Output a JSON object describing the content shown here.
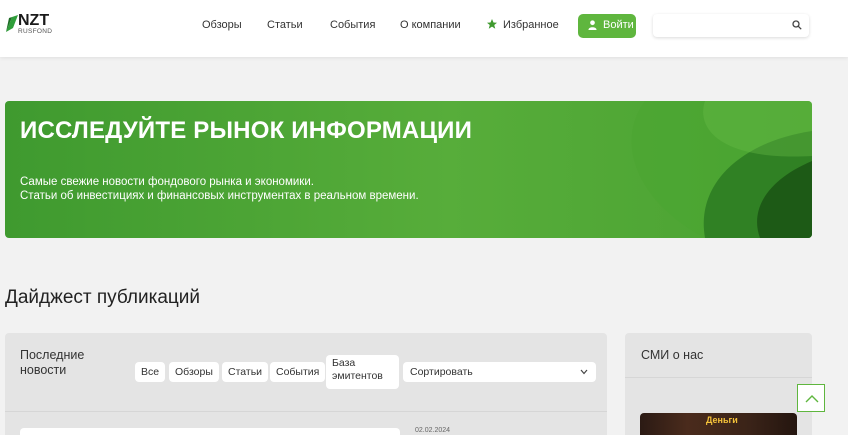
{
  "brand": {
    "name": "NZT",
    "subname": "RUSFOND",
    "accent": "#5fb63e"
  },
  "nav": {
    "items": [
      "Обзоры",
      "Статьи",
      "События",
      "О компании",
      "Избранное"
    ],
    "login_label": "Войти",
    "search_placeholder": ""
  },
  "hero": {
    "title": "ИССЛЕДУЙТЕ РЫНОК ИНФОРМАЦИИ",
    "subtitle_line1": "Самые свежие новости фондового рынка и экономики.",
    "subtitle_line2": "Статьи об инвестициях и финансовых инструментах в реальном времени."
  },
  "digest": {
    "title": "Дайджест публикаций",
    "panel_title": "Последние новости",
    "filters": [
      "Все",
      "Обзоры",
      "Статьи",
      "События",
      "База эмитентов"
    ],
    "sort_label": "Сортировать",
    "first_date": "02.02.2024"
  },
  "sidebar": {
    "title": "СМИ о нас",
    "thumb_text": "Деньги"
  }
}
